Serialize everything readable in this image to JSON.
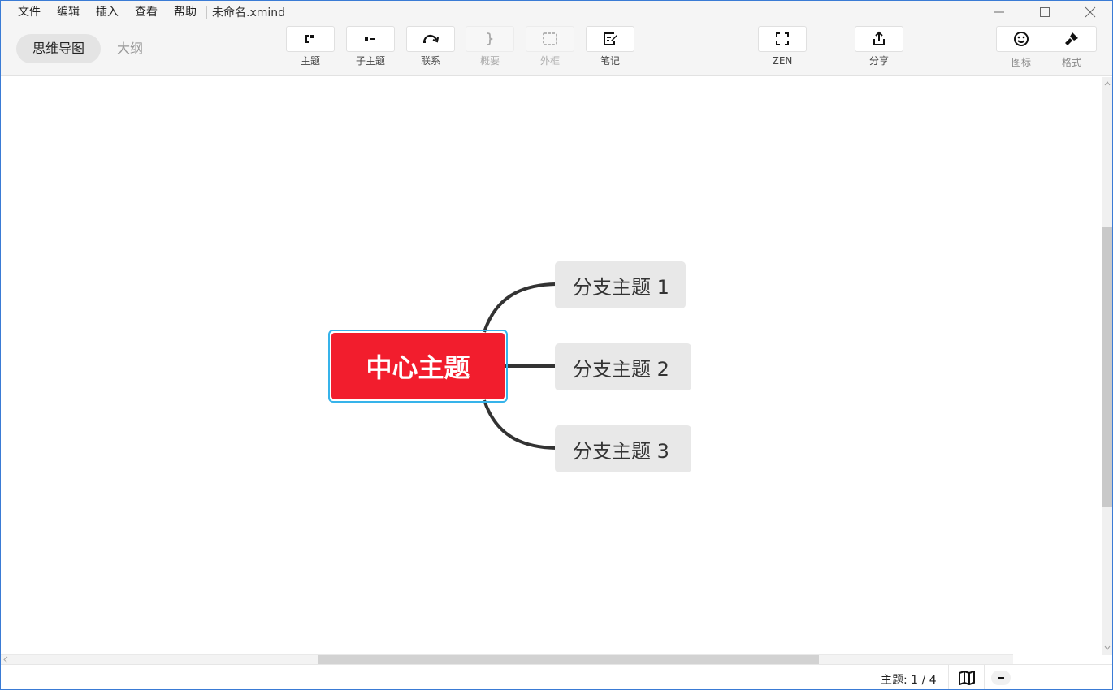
{
  "menubar": {
    "items": [
      {
        "label": "文件"
      },
      {
        "label": "编辑"
      },
      {
        "label": "插入"
      },
      {
        "label": "查看"
      },
      {
        "label": "帮助"
      }
    ],
    "doc_title": "未命名.xmind"
  },
  "view_switch": {
    "mindmap": "思维导图",
    "outline": "大纲",
    "active": "mindmap"
  },
  "toolbar": {
    "topic": {
      "label": "主题",
      "icon": "topic-icon"
    },
    "subtopic": {
      "label": "子主题",
      "icon": "subtopic-icon"
    },
    "relationship": {
      "label": "联系",
      "icon": "relationship-icon"
    },
    "summary": {
      "label": "概要",
      "icon": "summary-brace-icon",
      "disabled": true
    },
    "boundary": {
      "label": "外框",
      "icon": "boundary-icon",
      "disabled": true
    },
    "notes": {
      "label": "笔记",
      "icon": "notes-icon"
    },
    "zen": {
      "label": "ZEN",
      "icon": "fullscreen-icon"
    },
    "share": {
      "label": "分享",
      "icon": "share-icon"
    },
    "icons": {
      "label": "图标",
      "icon": "smiley-icon"
    },
    "format": {
      "label": "格式",
      "icon": "brush-icon"
    }
  },
  "mindmap": {
    "central_topic": "中心主题",
    "branches": [
      {
        "label": "分支主题 1"
      },
      {
        "label": "分支主题 2"
      },
      {
        "label": "分支主题 3"
      }
    ],
    "colors": {
      "central_fill": "#f21d2d",
      "selection": "#36b3ea",
      "branch_fill": "#e8e8e8",
      "connector": "#333333"
    }
  },
  "statusbar": {
    "topic_count": "主题: 1 / 4",
    "map_icon": "map-icon",
    "zoom_icon": "minus-icon"
  }
}
